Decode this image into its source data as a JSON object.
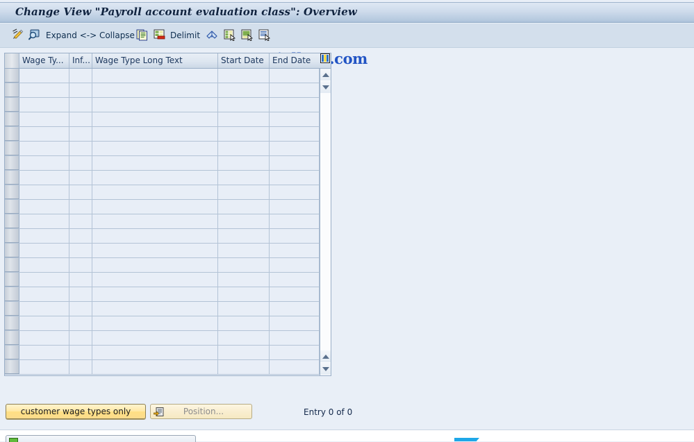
{
  "window": {
    "title": "Change View \"Payroll account evaluation class\": Overview"
  },
  "toolbar": {
    "items": [
      {
        "name": "display-change-icon",
        "icon": "pencil-icon",
        "label": ""
      },
      {
        "name": "display-detail-icon",
        "icon": "magnifier-icon",
        "label": ""
      },
      {
        "name": "expand-collapse-button",
        "icon": "",
        "label": "Expand <-> Collapse"
      },
      {
        "name": "copy-as-icon",
        "icon": "copy-icon",
        "label": ""
      },
      {
        "name": "delete-icon",
        "icon": "delete-row-icon",
        "label": ""
      },
      {
        "name": "delimit-button",
        "icon": "",
        "label": "Delimit"
      },
      {
        "name": "undo-icon",
        "icon": "undo-arrow-icon",
        "label": ""
      },
      {
        "name": "select-all-icon",
        "icon": "select-all-icon",
        "label": ""
      },
      {
        "name": "deselect-all-icon",
        "icon": "deselect-all-icon",
        "label": ""
      },
      {
        "name": "select-block-icon",
        "icon": "select-block-icon",
        "label": ""
      }
    ],
    "watermark": "www.tutorialkart.com",
    "watermark_prefix": "www.tut",
    "watermark_suffix": "orialkart.com"
  },
  "table": {
    "columns": [
      {
        "name": "row-selector",
        "label": ""
      },
      {
        "name": "wage-type",
        "label": "Wage Ty..."
      },
      {
        "name": "infotype",
        "label": "Inf..."
      },
      {
        "name": "wage-type-long-text",
        "label": "Wage Type Long Text"
      },
      {
        "name": "start-date",
        "label": "Start Date"
      },
      {
        "name": "end-date",
        "label": "End Date"
      },
      {
        "name": "table-settings",
        "label": ""
      }
    ],
    "rows": [],
    "visible_row_count": 21,
    "scrollbar": {
      "up_arrow": "scroll-up-arrow",
      "down_arrow": "scroll-down-arrow"
    }
  },
  "footer": {
    "customer_wage_types_button": "customer wage types only",
    "position_button": "Position...",
    "position_icon": "position-icon",
    "entry_count": "Entry 0 of 0"
  },
  "colors": {
    "title_bar_top": "#dee8f3",
    "title_bar_bottom": "#a6bdd6",
    "toolbar_bg": "#d3dfec",
    "page_bg": "#e9eff7",
    "grid_cell": "#e8eef7",
    "grid_border": "#9aafc8",
    "button_yellow": "#ffe9a6",
    "watermark_blue": "#2254c4"
  }
}
